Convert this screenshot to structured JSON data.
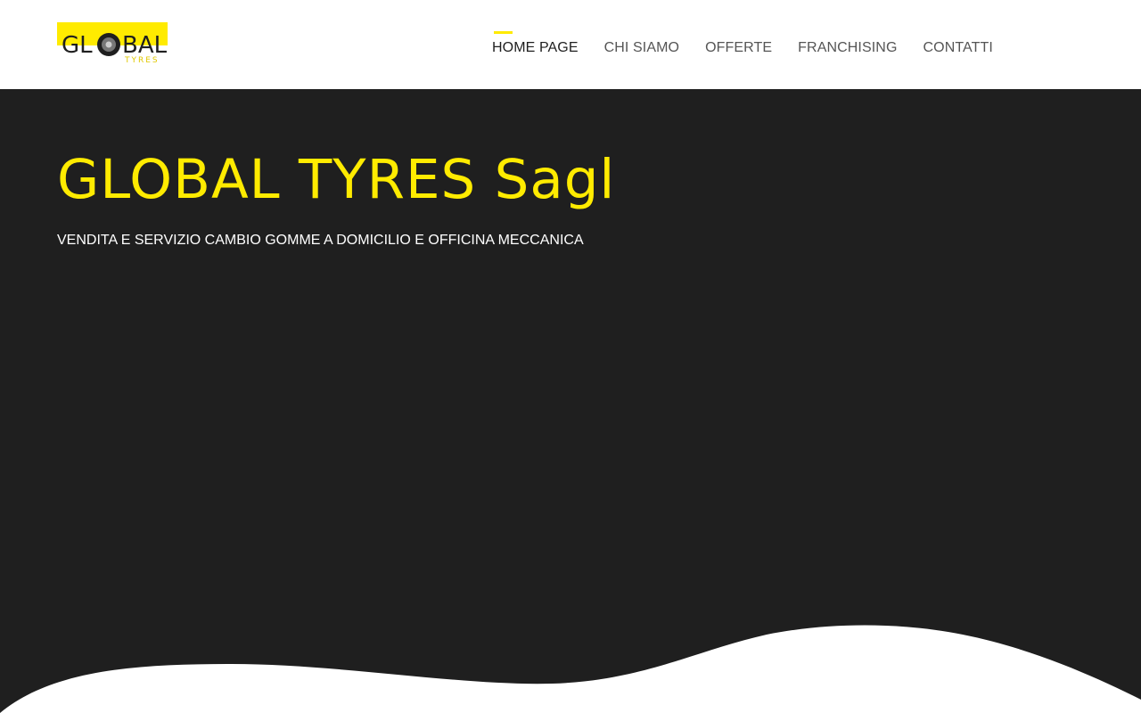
{
  "logo": {
    "text_top": "GL BAL",
    "text_bottom": "TYRES",
    "brand_color": "#ffeb00",
    "icon": "tyre-icon"
  },
  "nav": {
    "items": [
      {
        "label": "HOME PAGE",
        "active": true
      },
      {
        "label": "CHI SIAMO",
        "active": false
      },
      {
        "label": "OFFERTE",
        "active": false
      },
      {
        "label": "FRANCHISING",
        "active": false
      },
      {
        "label": "CONTATTI",
        "active": false
      }
    ]
  },
  "hero": {
    "title": "GLOBAL TYRES Sagl",
    "subtitle": "VENDITA E SERVIZIO CAMBIO GOMME A DOMICILIO E OFFICINA MECCANICA",
    "background_color": "#1f1f1f",
    "title_color": "#ffeb00"
  }
}
